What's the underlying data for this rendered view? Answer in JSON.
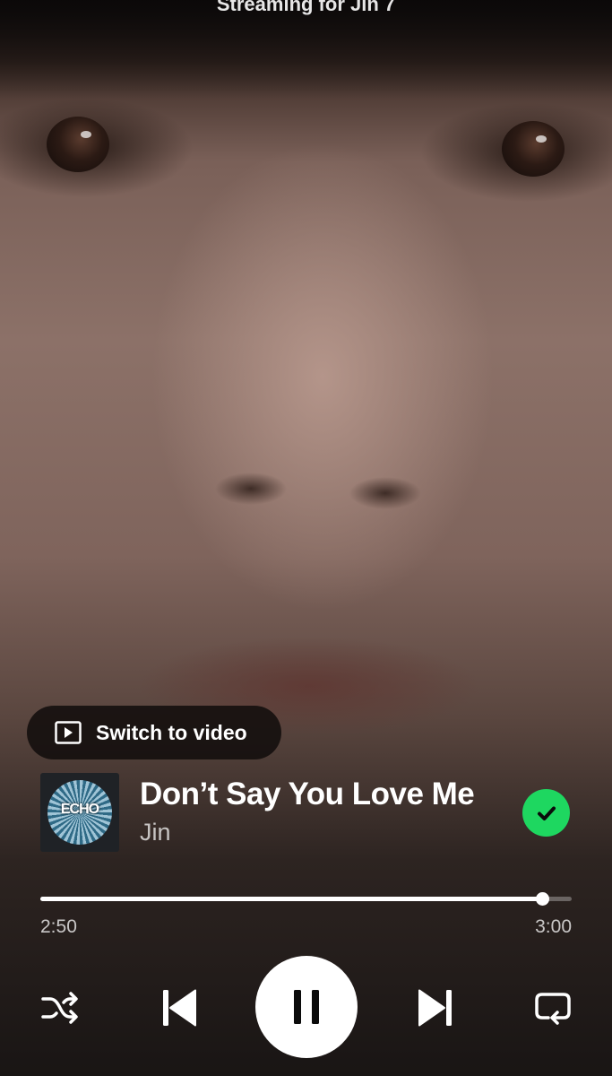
{
  "header": {
    "top_text": "Streaming for Jin 7"
  },
  "video_button": {
    "label": "Switch to video",
    "icon": "video-play-icon"
  },
  "album_art": {
    "logo_text": "ECHO"
  },
  "track": {
    "title": "Don’t Say You Love Me",
    "artist": "Jin"
  },
  "status": {
    "added_icon": "check-circle-icon",
    "accent_color": "#1ed760"
  },
  "progress": {
    "elapsed": "2:50",
    "total": "3:00",
    "fraction": 0.945
  },
  "controls": {
    "shuffle_icon": "shuffle-icon",
    "previous_icon": "skip-previous-icon",
    "play_pause_icon": "pause-icon",
    "next_icon": "skip-next-icon",
    "repeat_icon": "repeat-icon"
  }
}
